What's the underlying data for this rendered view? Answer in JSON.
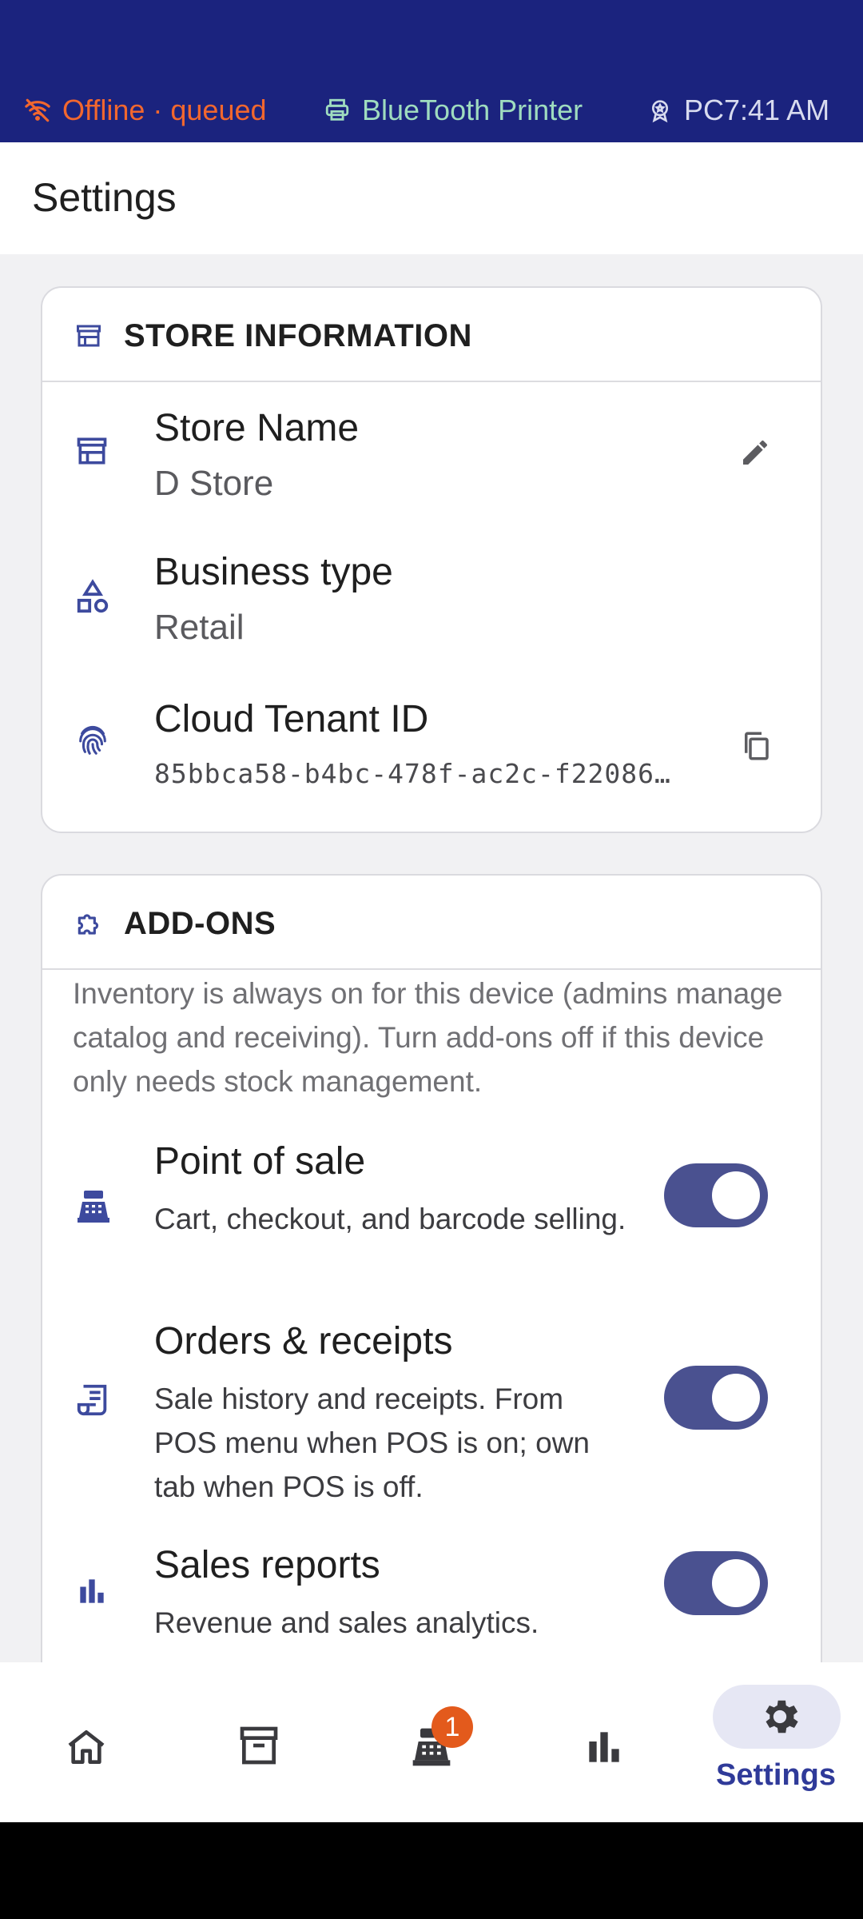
{
  "status_bar": {
    "offline_text": "Offline · queued",
    "printer_text": "BlueTooth Printer",
    "pc_time_text": "PC7:41 AM",
    "colors": {
      "background": "#1b237e",
      "offline": "#f2672e",
      "printer": "#9fdcbf"
    }
  },
  "header": {
    "title": "Settings"
  },
  "store_info": {
    "section_title": "STORE INFORMATION",
    "section_icon": "storefront-icon",
    "rows": [
      {
        "icon": "storefront-icon",
        "label": "Store Name",
        "value": "D Store",
        "action_icon": "pencil-icon"
      },
      {
        "icon": "shapes-icon",
        "label": "Business type",
        "value": "Retail"
      },
      {
        "icon": "fingerprint-icon",
        "label": "Cloud Tenant ID",
        "value": "85bbca58-b4bc-478f-ac2c-f22086…",
        "action_icon": "copy-icon"
      }
    ]
  },
  "addons": {
    "section_title": "ADD-ONS",
    "section_icon": "puzzle-icon",
    "description": "Inventory is always on for this device (admins manage catalog and receiving). Turn add-ons off if this device only needs stock management.",
    "items": [
      {
        "icon": "cash-register-icon",
        "title": "Point of sale",
        "subtitle": "Cart, checkout, and barcode selling.",
        "enabled": true
      },
      {
        "icon": "receipt-icon",
        "title": "Orders & receipts",
        "subtitle": "Sale history and receipts. From POS menu when POS is on; own tab when POS is off.",
        "enabled": true
      },
      {
        "icon": "bar-chart-icon",
        "title": "Sales reports",
        "subtitle": "Revenue and sales analytics.",
        "enabled": true
      }
    ]
  },
  "bottom_nav": {
    "items": [
      {
        "icon": "home-icon"
      },
      {
        "icon": "archive-box-icon"
      },
      {
        "icon": "cash-register-icon",
        "badge": "1"
      },
      {
        "icon": "bar-chart-icon"
      },
      {
        "icon": "gear-icon",
        "label": "Settings",
        "active": true
      }
    ],
    "accent_color": "#2f3a99",
    "badge_color": "#e35a1c"
  }
}
